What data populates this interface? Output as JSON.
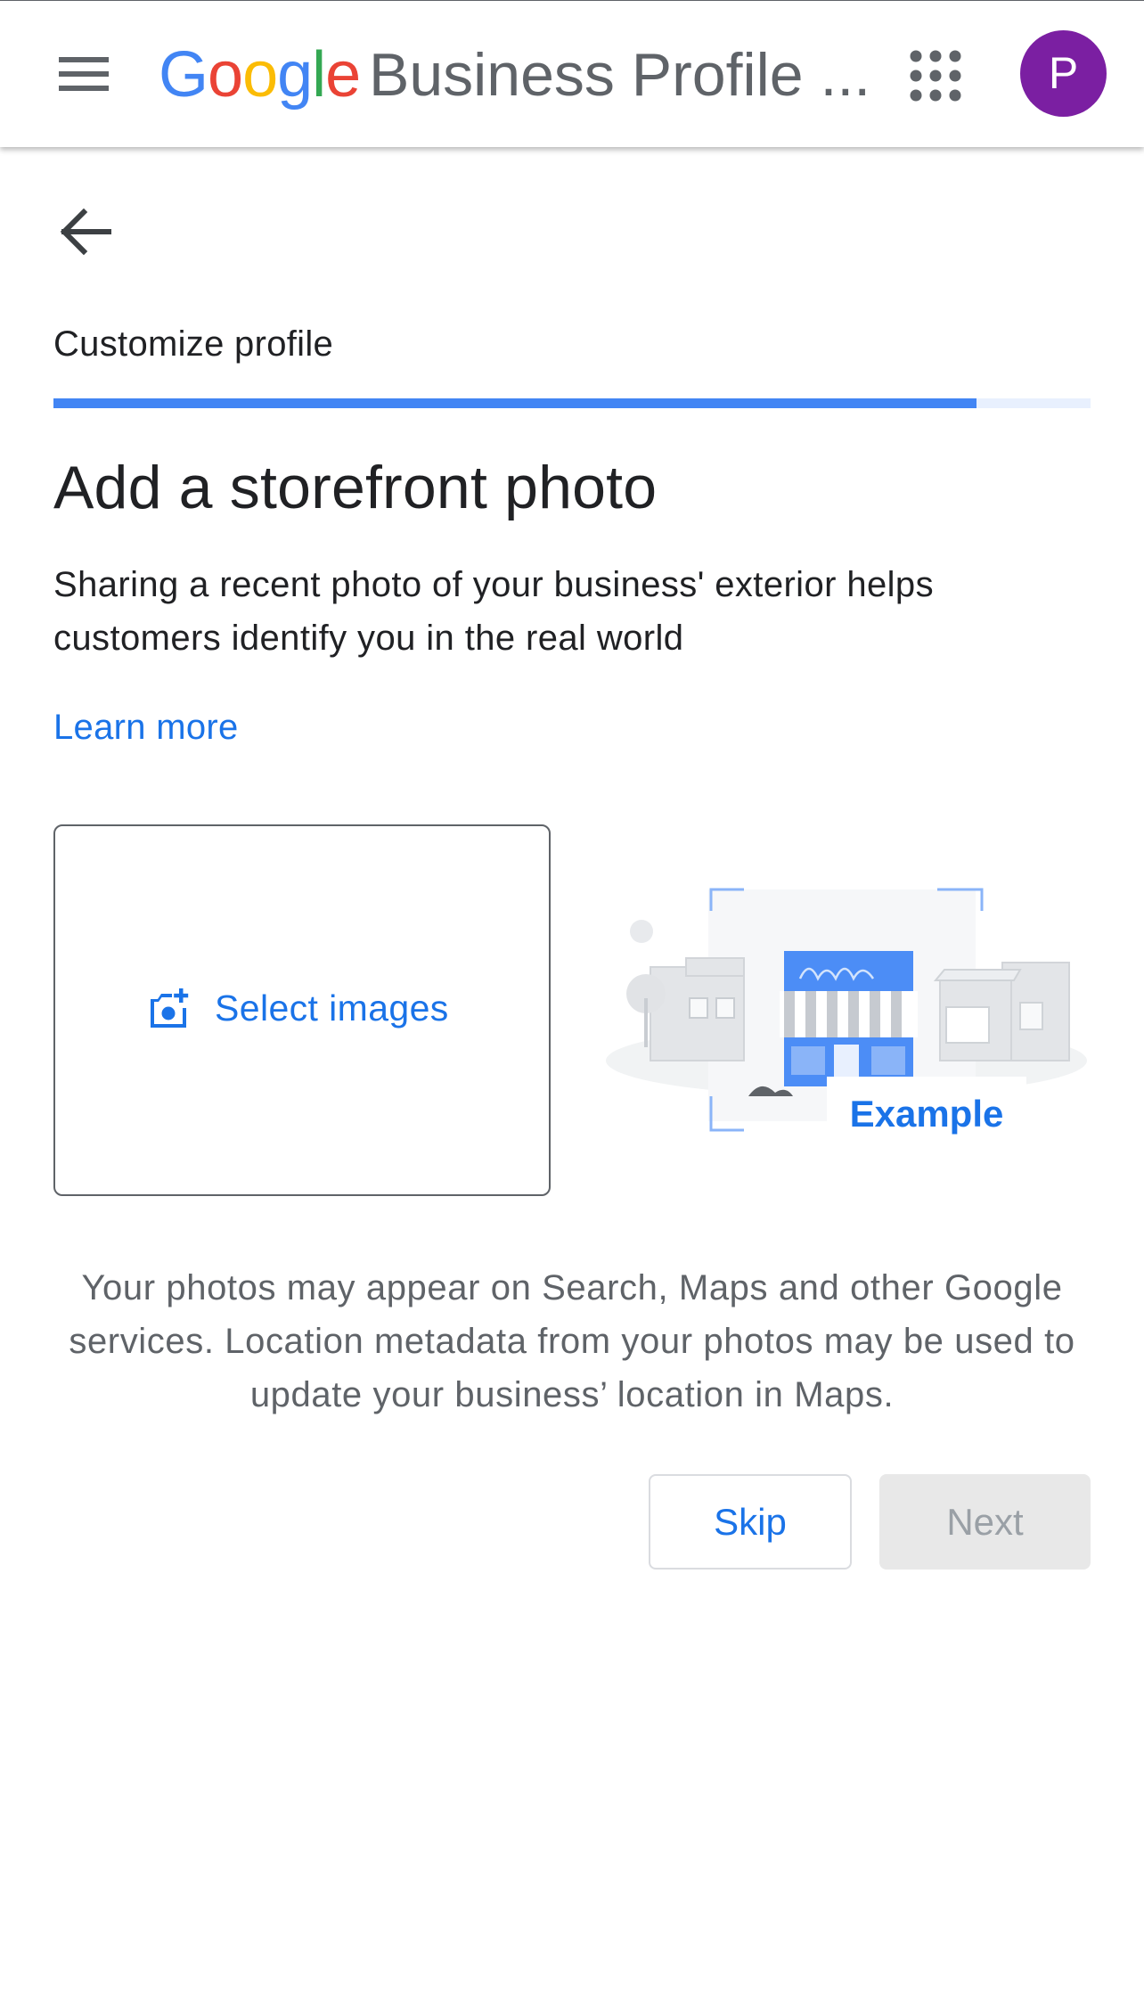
{
  "appbar": {
    "menu_icon": "hamburger-menu-icon",
    "logo_letters": [
      {
        "char": "G",
        "color": "#4285F4"
      },
      {
        "char": "o",
        "color": "#EA4335"
      },
      {
        "char": "o",
        "color": "#FBBC05"
      },
      {
        "char": "g",
        "color": "#4285F4"
      },
      {
        "char": "l",
        "color": "#34A853"
      },
      {
        "char": "e",
        "color": "#EA4335"
      }
    ],
    "title": "Business Profile ...",
    "apps_icon": "apps-grid-icon",
    "avatar_initial": "P",
    "avatar_color": "#7B1FA2"
  },
  "back_icon": "arrow-back-icon",
  "step": {
    "label": "Customize profile",
    "progress_fraction": 0.89
  },
  "main": {
    "heading": "Add a storefront photo",
    "description": "Sharing a recent photo of your business' exterior helps customers identify you in the real world",
    "learn_more": "Learn more",
    "select_images_icon": "add-photo-icon",
    "select_images_label": "Select images",
    "example_label": "Example",
    "disclaimer": "Your photos may appear on Search, Maps and other Google services. Location metadata from your photos may be used to update your business’ location in Maps."
  },
  "actions": {
    "skip": "Skip",
    "next": "Next"
  },
  "colors": {
    "accent": "#1A73E8",
    "progress": "#4285F4",
    "progress_track": "#E8F0FE"
  }
}
